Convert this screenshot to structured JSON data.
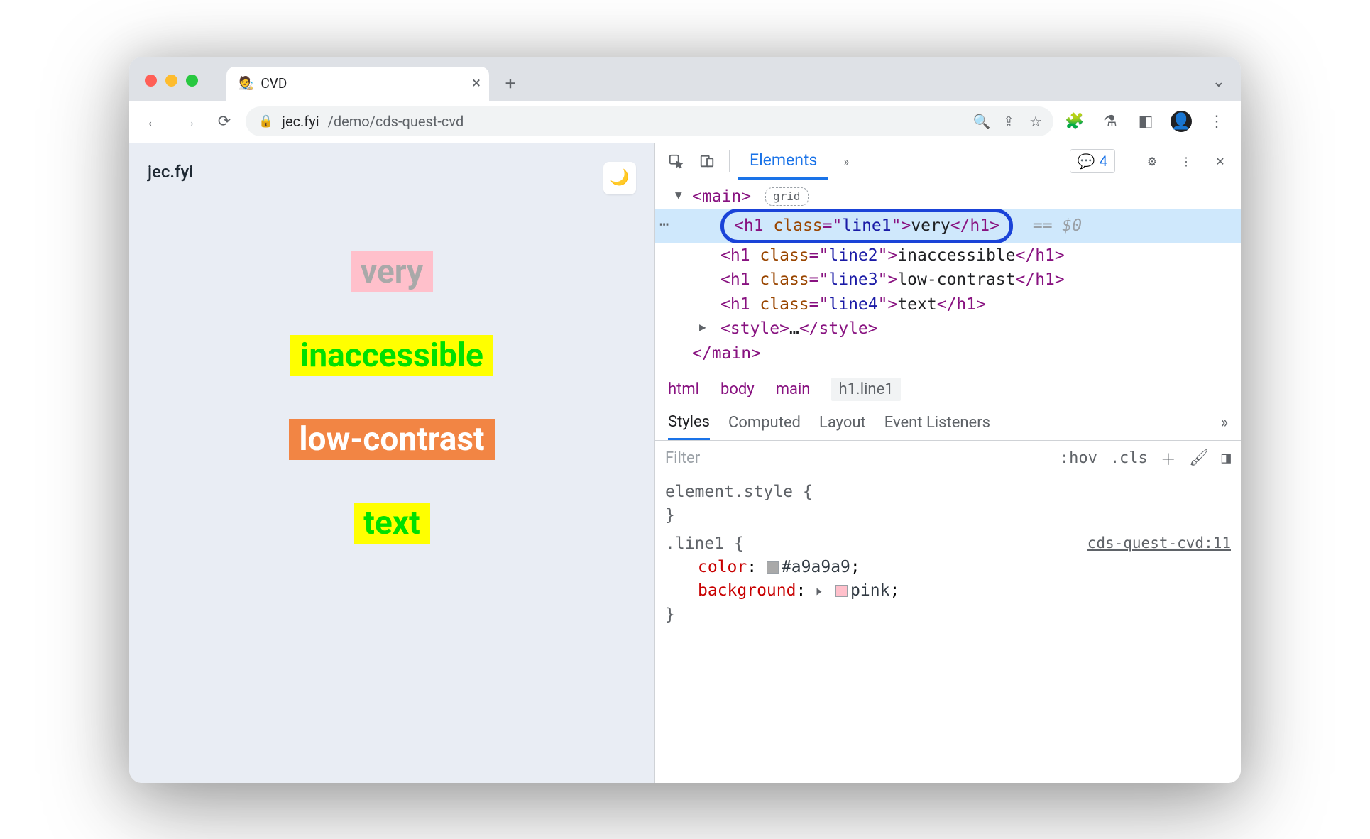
{
  "tab": {
    "title": "CVD",
    "favicon": "🧑‍🎨"
  },
  "url": {
    "host": "jec.fyi",
    "path": "/demo/cds-quest-cvd"
  },
  "page": {
    "site_title": "jec.fyi",
    "words": {
      "w1": "very",
      "w2": "inaccessible",
      "w3": "low-contrast",
      "w4": "text"
    }
  },
  "devtools": {
    "tabs": {
      "elements": "Elements"
    },
    "issues_count": "4",
    "dom": {
      "main_open": "main",
      "grid_pill": "grid",
      "h1_tag": "h1",
      "class_attr": "class",
      "line1_val": "line1",
      "line1_txt": "very",
      "line2_val": "line2",
      "line2_txt": "inaccessible",
      "line3_val": "line3",
      "line3_txt": "low-contrast",
      "line4_val": "line4",
      "line4_txt": "text",
      "style_tag": "style",
      "eqdol": "== $0"
    },
    "breadcrumb": {
      "b1": "html",
      "b2": "body",
      "b3": "main",
      "b4": "h1.line1"
    },
    "styles_tabs": {
      "styles": "Styles",
      "computed": "Computed",
      "layout": "Layout",
      "listeners": "Event Listeners"
    },
    "filter": {
      "placeholder": "Filter",
      "hov": ":hov",
      "cls": ".cls"
    },
    "rules": {
      "elstyle": "element.style {",
      "close": "}",
      "sel1": ".line1 {",
      "src1": "cds-quest-cvd:11",
      "p1_name": "color",
      "p1_val": "#a9a9a9",
      "p1_swatch": "#a9a9a9",
      "p2_name": "background",
      "p2_val": "pink",
      "p2_swatch": "#ffc0cb"
    }
  }
}
